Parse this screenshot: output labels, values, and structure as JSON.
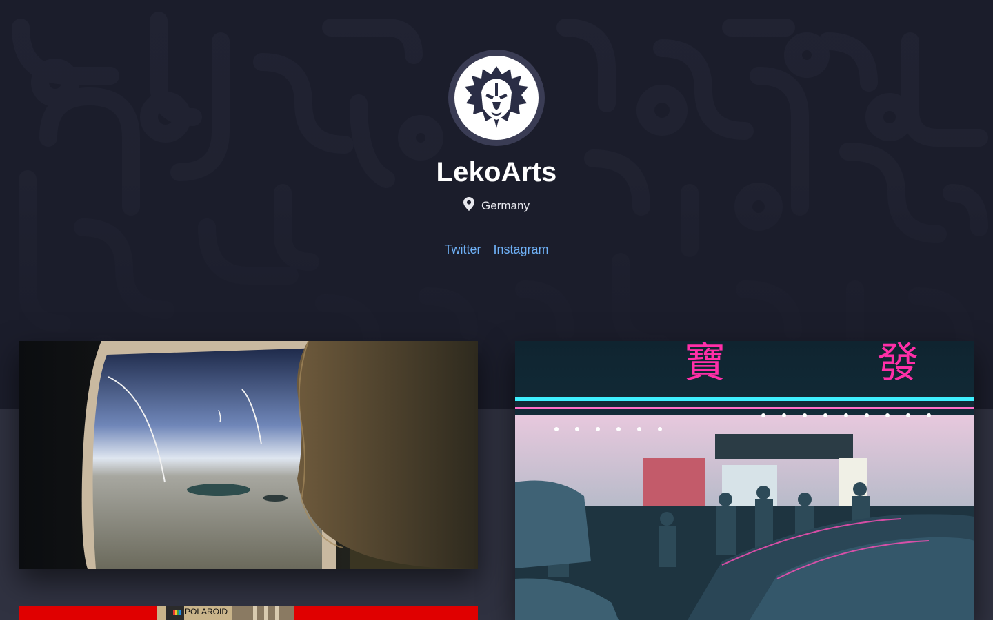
{
  "profile": {
    "name": "LekoArts",
    "location": "Germany",
    "avatar_icon": "lion-logo-icon"
  },
  "social_links": [
    {
      "label": "Twitter"
    },
    {
      "label": "Instagram"
    }
  ],
  "gallery": {
    "items": [
      {
        "subject": "airplane-window-earth-view"
      },
      {
        "subject": "neon-night-street-restaurant",
        "sign_text": "寶發"
      },
      {
        "subject": "polaroid-camera-red",
        "brand": "POLAROID"
      }
    ]
  },
  "colors": {
    "hero_bg": "#1b1d2b",
    "page_bg": "#303241",
    "link": "#6fb1f7",
    "neon_pink": "#ff2fa8",
    "neon_cyan": "#3ff0ff"
  }
}
